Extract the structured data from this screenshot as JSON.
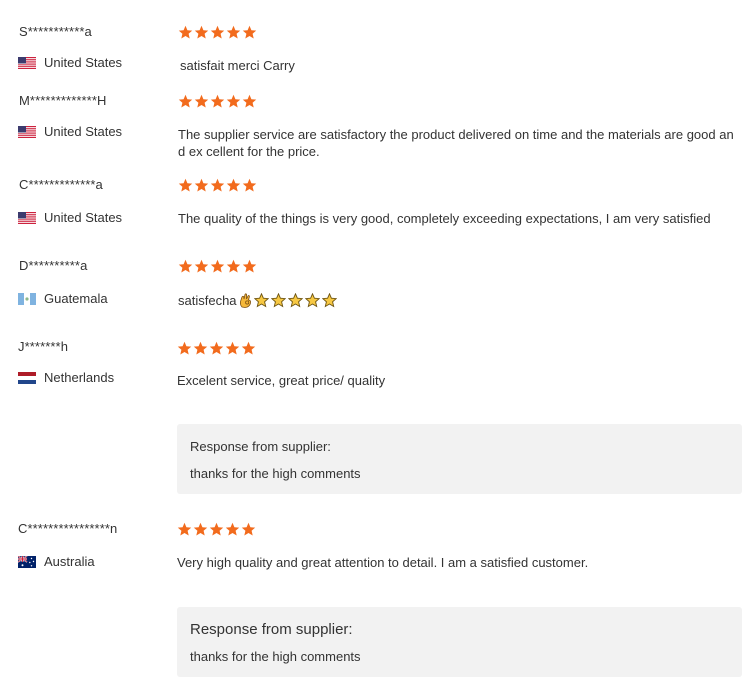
{
  "colors": {
    "star": "#f26b1d",
    "response_bg": "#f2f2f2",
    "text": "#333333"
  },
  "reviews": [
    {
      "name": "S***********a",
      "country": "United States",
      "flag": "us",
      "rating": 5,
      "text": "satisfait merci Carry"
    },
    {
      "name": "M*************H",
      "country": "United States",
      "flag": "us",
      "rating": 5,
      "text": "The supplier service are satisfactory the product delivered on time and the materials are good and ex cellent for the price."
    },
    {
      "name": "C*************a",
      "country": "United States",
      "flag": "us",
      "rating": 5,
      "text": "The quality of the things is very good, completely exceeding expectations, I am very satisfied"
    },
    {
      "name": "D**********a",
      "country": "Guatemala",
      "flag": "gt",
      "rating": 5,
      "text": "satisfecha",
      "emoji": [
        "ok-hand-icon",
        "star-icon",
        "star-icon",
        "star-icon",
        "star-icon",
        "star-icon"
      ]
    },
    {
      "name": "J*******h",
      "country": "Netherlands",
      "flag": "nl",
      "rating": 5,
      "text": "Excelent service, great price/ quality",
      "response_title": "Response from supplier:",
      "response_text": "thanks for the high comments"
    },
    {
      "name": "C****************n",
      "country": "Australia",
      "flag": "au",
      "rating": 5,
      "text": "Very high quality and great attention to detail. I am a satisfied customer.",
      "response_title": "Response from supplier:",
      "response_text": "thanks for the high comments"
    }
  ]
}
